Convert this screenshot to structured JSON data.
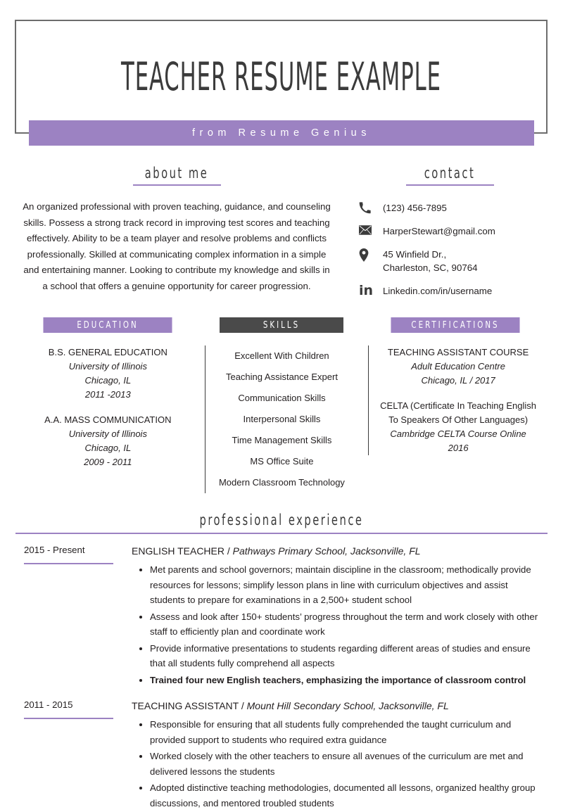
{
  "header": {
    "title": "TEACHER RESUME EXAMPLE",
    "banner": "from Resume Genius"
  },
  "about": {
    "heading": "about me",
    "text": "An organized professional with proven teaching, guidance, and counseling skills. Possess a strong track record in improving test scores and teaching effectively. Ability to be a team player and resolve problems and conflicts professionally. Skilled at communicating complex information in a simple and entertaining manner. Looking to contribute my knowledge and skills in a school that offers a genuine opportunity for career progression."
  },
  "contact": {
    "heading": "contact",
    "items": [
      {
        "icon": "phone-icon",
        "value": "(123) 456-7895"
      },
      {
        "icon": "envelope-icon",
        "value": "HarperStewart@gmail.com"
      },
      {
        "icon": "location-pin-icon",
        "line1": "45 Winfield Dr.,",
        "line2": "Charleston, SC, 90764"
      },
      {
        "icon": "linkedin-icon",
        "value": "Linkedin.com/in/username"
      }
    ]
  },
  "education": {
    "label": "EDUCATION",
    "entries": [
      {
        "degree": "B.S. GENERAL EDUCATION",
        "school": "University of Illinois",
        "location": "Chicago, IL",
        "years": "2011 -2013"
      },
      {
        "degree": "A.A. MASS COMMUNICATION",
        "school": "University of Illinois",
        "location": "Chicago, IL",
        "years": "2009 - 2011"
      }
    ]
  },
  "skills": {
    "label": "SKILLS",
    "items": [
      "Excellent With Children",
      "Teaching Assistance Expert",
      "Communication  Skills",
      "Interpersonal Skills",
      "Time Management Skills",
      "MS Office Suite",
      "Modern Classroom Technology"
    ]
  },
  "certifications": {
    "label": "CERTIFICATIONS",
    "entries": [
      {
        "name": "TEACHING ASSISTANT COURSE",
        "institution": "Adult Education Centre",
        "detail": "Chicago, IL  /  2017"
      },
      {
        "name": "CELTA (Certificate In Teaching English To Speakers Of Other Languages)",
        "institution": "Cambridge CELTA Course Online",
        "detail": "2016"
      }
    ]
  },
  "experience": {
    "heading": "professional experience",
    "entries": [
      {
        "date": "2015 - Present",
        "role": "ENGLISH TEACHER / ",
        "org": "Pathways Primary School, Jacksonville, FL",
        "bullets": [
          {
            "text": "Met parents and school governors; maintain discipline in the classroom; methodically provide resources for lessons; simplify lesson plans in line with curriculum objectives and assist students to prepare for examinations in a 2,500+ student school",
            "bold": false
          },
          {
            "text": "Assess and look after 150+ students’ progress throughout the term and work closely with other staff to efficiently plan and coordinate work",
            "bold": false
          },
          {
            "text": "Provide informative presentations to students regarding different areas of studies and ensure that all students fully comprehend all aspects",
            "bold": false
          },
          {
            "text": "Trained four new English teachers, emphasizing the importance of classroom control",
            "bold": true
          }
        ]
      },
      {
        "date": "2011 - 2015",
        "role": "TEACHING ASSISTANT / ",
        "org": "Mount Hill Secondary School, Jacksonville, FL",
        "bullets": [
          {
            "text": "Responsible for ensuring that all students fully comprehended the taught curriculum and provided support to students who required extra guidance",
            "bold": false
          },
          {
            "text": "Worked closely with the other teachers to ensure all avenues of the curriculum are met and delivered lessons the students",
            "bold": false
          },
          {
            "text": "Adopted distinctive teaching methodologies, documented all lessons, organized healthy group discussions, and mentored troubled students",
            "bold": false
          }
        ]
      }
    ]
  },
  "colors": {
    "accent_purple": "#9c82c2",
    "dark_label": "#4a4a4a",
    "text": "#231f20",
    "frame": "#6d6d6d"
  }
}
